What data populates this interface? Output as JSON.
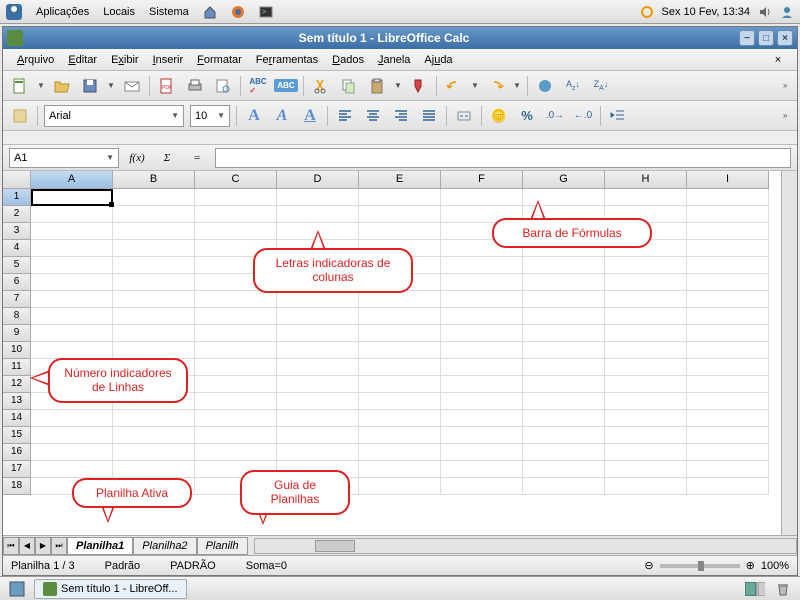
{
  "gnome": {
    "menu1": "Aplicações",
    "menu2": "Locais",
    "menu3": "Sistema",
    "clock": "Sex 10 Fev, 13:34"
  },
  "window": {
    "title": "Sem título 1 - LibreOffice Calc"
  },
  "menubar": {
    "items": [
      "Arquivo",
      "Editar",
      "Exibir",
      "Inserir",
      "Formatar",
      "Ferramentas",
      "Dados",
      "Janela",
      "Ajuda"
    ]
  },
  "format": {
    "font_name": "Arial",
    "font_size": "10"
  },
  "formula": {
    "cell_ref": "A1",
    "fx_label": "f(x)",
    "sum_label": "Σ",
    "eq_label": "=",
    "value": ""
  },
  "columns": [
    "A",
    "B",
    "C",
    "D",
    "E",
    "F",
    "G",
    "H",
    "I"
  ],
  "rows": [
    "1",
    "2",
    "3",
    "4",
    "5",
    "6",
    "7",
    "8",
    "9",
    "10",
    "11",
    "12",
    "13",
    "14",
    "15",
    "16",
    "17",
    "18"
  ],
  "active_col": "A",
  "active_row": "1",
  "sheets": {
    "tabs": [
      "Planilha1",
      "Planilha2",
      "Planilh"
    ],
    "active": 0
  },
  "status": {
    "sheet_pos": "Planilha 1 / 3",
    "style": "Padrão",
    "mode": "PADRÃO",
    "sum": "Soma=0",
    "zoom": "100%"
  },
  "taskbar": {
    "item": "Sem título 1 - LibreOff..."
  },
  "annotations": {
    "formulabar": "Barra de Fórmulas",
    "columns": "Letras indicadoras de colunas",
    "rows": "Número indicadores de Linhas",
    "activesheet": "Planilha Ativa",
    "sheettabs": "Guia de Planilhas"
  }
}
